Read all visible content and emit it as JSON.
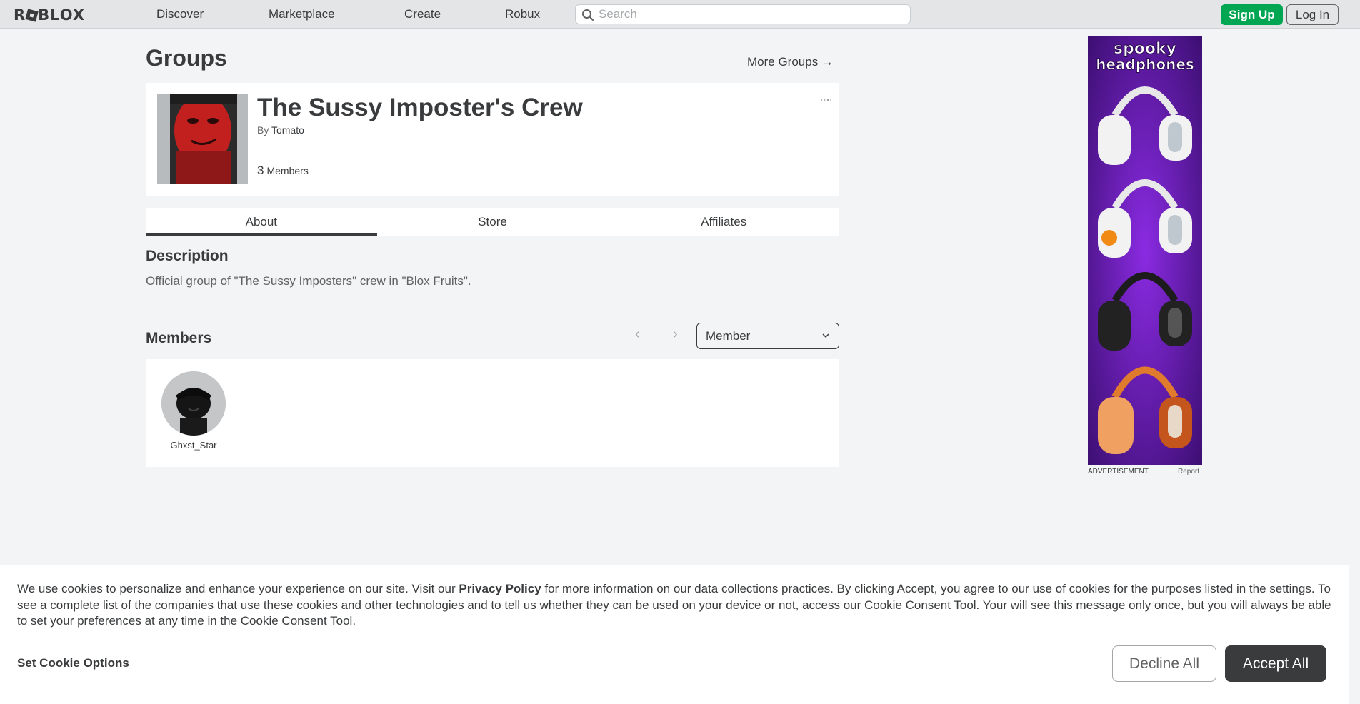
{
  "nav": {
    "logo": "ROBLOX",
    "links": [
      "Discover",
      "Marketplace",
      "Create",
      "Robux"
    ],
    "search_placeholder": "Search",
    "signup": "Sign Up",
    "login": "Log In"
  },
  "page": {
    "title": "Groups",
    "more_groups": "More Groups →"
  },
  "group": {
    "name": "The Sussy Imposter's Crew",
    "by_prefix": "By",
    "owner": "Tomato",
    "member_count": "3",
    "members_label": "Members"
  },
  "tabs": [
    "About",
    "Store",
    "Affiliates"
  ],
  "description": {
    "title": "Description",
    "text": "Official group of \"The Sussy Imposters\" crew in \"Blox Fruits\"."
  },
  "members": {
    "title": "Members",
    "role": "Member",
    "list": [
      {
        "name": "Ghxst_Star"
      }
    ]
  },
  "ad": {
    "headline_1": "spooky",
    "headline_2": "headphones",
    "label": "ADVERTISEMENT",
    "report": "Report"
  },
  "cookie": {
    "text_before": "We use cookies to personalize and enhance your experience on our site. Visit our ",
    "policy_link": "Privacy Policy",
    "text_after": " for more information on our data collections practices. By clicking Accept, you agree to our use of cookies for the purposes listed in the settings. To see a complete list of the companies that use these cookies and other technologies and to tell us whether they can be used on your device or not, access our Cookie Consent Tool. Your will see this message only once, but you will always be able to set your preferences at any time in the Cookie Consent Tool.",
    "set_options": "Set Cookie Options",
    "decline": "Decline All",
    "accept": "Accept All"
  },
  "colors": {
    "nav_bg": "#e3e5e7",
    "page_bg": "#f2f4f5",
    "signup_green": "#00a651",
    "dark_button": "#393b3d",
    "ad_purple": "#5b1a9a"
  }
}
